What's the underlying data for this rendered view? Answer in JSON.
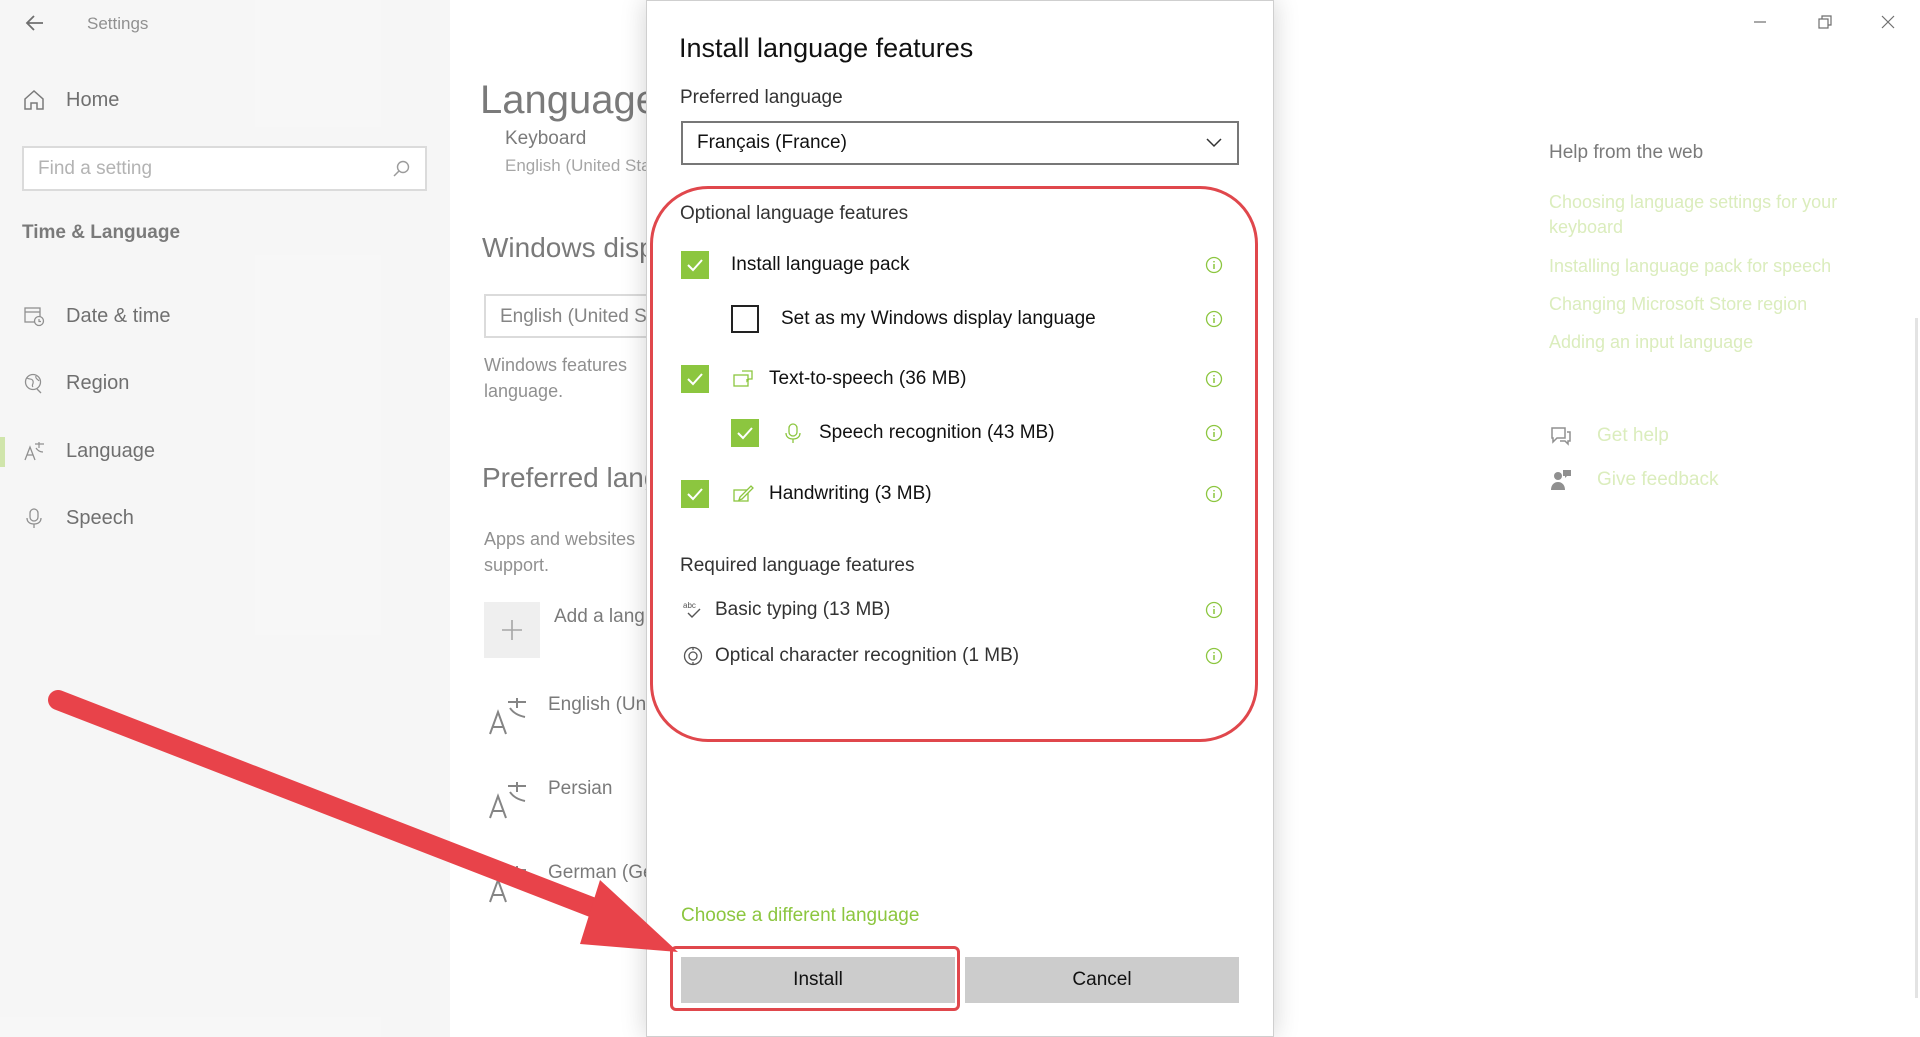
{
  "window": {
    "title": "Settings"
  },
  "nav": {
    "home": "Home",
    "search_placeholder": "Find a setting",
    "section": "Time & Language",
    "items": [
      {
        "label": "Date & time",
        "icon": "calendar-clock-icon"
      },
      {
        "label": "Region",
        "icon": "globe-icon"
      },
      {
        "label": "Language",
        "icon": "language-icon",
        "active": true
      },
      {
        "label": "Speech",
        "icon": "microphone-icon"
      }
    ]
  },
  "main": {
    "heading": "Language",
    "keyboard_label": "Keyboard",
    "keyboard_value": "English (United Sta",
    "windows_display_heading": "Windows disp",
    "windows_display_value": "English (United S",
    "windows_features_text": [
      "Windows features",
      "language."
    ],
    "preferred_heading": "Preferred lang",
    "apps_text": [
      "Apps and websites",
      "support."
    ],
    "add_language": "Add a lang",
    "languages": [
      "English (Un",
      "Persian",
      "German (Ge"
    ]
  },
  "help": {
    "title": "Help from the web",
    "links": [
      "Choosing language settings for your keyboard",
      "Installing language pack for speech",
      "Changing Microsoft Store region",
      "Adding an input language"
    ],
    "get_help": "Get help",
    "give_feedback": "Give feedback"
  },
  "dialog": {
    "title": "Install language features",
    "preferred_label": "Preferred language",
    "preferred_value": "Français (France)",
    "optional_label": "Optional language features",
    "options": [
      {
        "label": "Install language pack",
        "checked": true
      },
      {
        "label": "Set as my Windows display language",
        "checked": false
      },
      {
        "label": "Text-to-speech (36 MB)",
        "checked": true,
        "icon": "speech-bubble-icon"
      },
      {
        "label": "Speech recognition (43 MB)",
        "checked": true,
        "icon": "microphone-icon"
      },
      {
        "label": "Handwriting (3 MB)",
        "checked": true,
        "icon": "pen-icon"
      }
    ],
    "required_label": "Required language features",
    "required": [
      {
        "label": "Basic typing (13 MB)",
        "icon": "abc-check-icon"
      },
      {
        "label": "Optical character recognition (1 MB)",
        "icon": "ocr-icon"
      }
    ],
    "choose_different": "Choose a different language",
    "install_label": "Install",
    "cancel_label": "Cancel"
  },
  "colors": {
    "accent_green": "#8cc63f",
    "annotation_red": "#e0474c",
    "button_grey": "#cccccc"
  }
}
